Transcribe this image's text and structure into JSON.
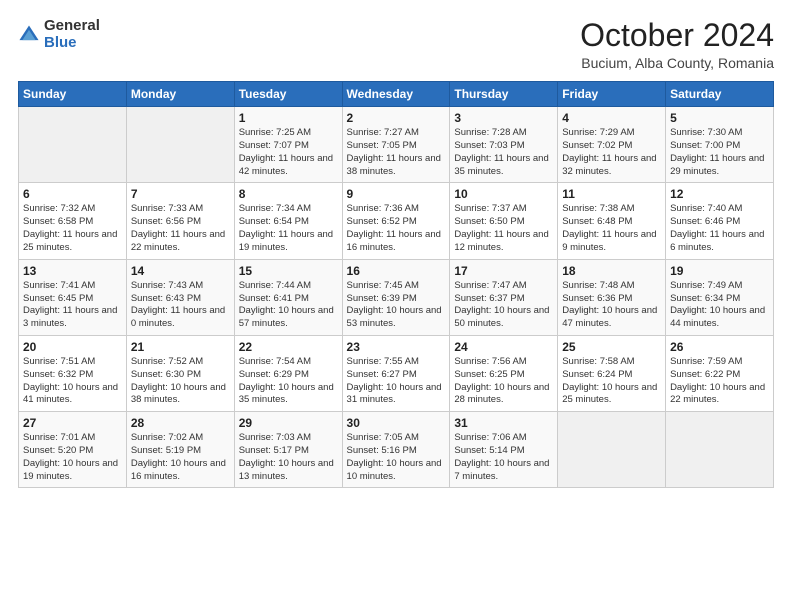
{
  "header": {
    "logo_general": "General",
    "logo_blue": "Blue",
    "month_title": "October 2024",
    "location": "Bucium, Alba County, Romania"
  },
  "days_of_week": [
    "Sunday",
    "Monday",
    "Tuesday",
    "Wednesday",
    "Thursday",
    "Friday",
    "Saturday"
  ],
  "weeks": [
    [
      {
        "day": "",
        "info": ""
      },
      {
        "day": "",
        "info": ""
      },
      {
        "day": "1",
        "info": "Sunrise: 7:25 AM\nSunset: 7:07 PM\nDaylight: 11 hours and 42 minutes."
      },
      {
        "day": "2",
        "info": "Sunrise: 7:27 AM\nSunset: 7:05 PM\nDaylight: 11 hours and 38 minutes."
      },
      {
        "day": "3",
        "info": "Sunrise: 7:28 AM\nSunset: 7:03 PM\nDaylight: 11 hours and 35 minutes."
      },
      {
        "day": "4",
        "info": "Sunrise: 7:29 AM\nSunset: 7:02 PM\nDaylight: 11 hours and 32 minutes."
      },
      {
        "day": "5",
        "info": "Sunrise: 7:30 AM\nSunset: 7:00 PM\nDaylight: 11 hours and 29 minutes."
      }
    ],
    [
      {
        "day": "6",
        "info": "Sunrise: 7:32 AM\nSunset: 6:58 PM\nDaylight: 11 hours and 25 minutes."
      },
      {
        "day": "7",
        "info": "Sunrise: 7:33 AM\nSunset: 6:56 PM\nDaylight: 11 hours and 22 minutes."
      },
      {
        "day": "8",
        "info": "Sunrise: 7:34 AM\nSunset: 6:54 PM\nDaylight: 11 hours and 19 minutes."
      },
      {
        "day": "9",
        "info": "Sunrise: 7:36 AM\nSunset: 6:52 PM\nDaylight: 11 hours and 16 minutes."
      },
      {
        "day": "10",
        "info": "Sunrise: 7:37 AM\nSunset: 6:50 PM\nDaylight: 11 hours and 12 minutes."
      },
      {
        "day": "11",
        "info": "Sunrise: 7:38 AM\nSunset: 6:48 PM\nDaylight: 11 hours and 9 minutes."
      },
      {
        "day": "12",
        "info": "Sunrise: 7:40 AM\nSunset: 6:46 PM\nDaylight: 11 hours and 6 minutes."
      }
    ],
    [
      {
        "day": "13",
        "info": "Sunrise: 7:41 AM\nSunset: 6:45 PM\nDaylight: 11 hours and 3 minutes."
      },
      {
        "day": "14",
        "info": "Sunrise: 7:43 AM\nSunset: 6:43 PM\nDaylight: 11 hours and 0 minutes."
      },
      {
        "day": "15",
        "info": "Sunrise: 7:44 AM\nSunset: 6:41 PM\nDaylight: 10 hours and 57 minutes."
      },
      {
        "day": "16",
        "info": "Sunrise: 7:45 AM\nSunset: 6:39 PM\nDaylight: 10 hours and 53 minutes."
      },
      {
        "day": "17",
        "info": "Sunrise: 7:47 AM\nSunset: 6:37 PM\nDaylight: 10 hours and 50 minutes."
      },
      {
        "day": "18",
        "info": "Sunrise: 7:48 AM\nSunset: 6:36 PM\nDaylight: 10 hours and 47 minutes."
      },
      {
        "day": "19",
        "info": "Sunrise: 7:49 AM\nSunset: 6:34 PM\nDaylight: 10 hours and 44 minutes."
      }
    ],
    [
      {
        "day": "20",
        "info": "Sunrise: 7:51 AM\nSunset: 6:32 PM\nDaylight: 10 hours and 41 minutes."
      },
      {
        "day": "21",
        "info": "Sunrise: 7:52 AM\nSunset: 6:30 PM\nDaylight: 10 hours and 38 minutes."
      },
      {
        "day": "22",
        "info": "Sunrise: 7:54 AM\nSunset: 6:29 PM\nDaylight: 10 hours and 35 minutes."
      },
      {
        "day": "23",
        "info": "Sunrise: 7:55 AM\nSunset: 6:27 PM\nDaylight: 10 hours and 31 minutes."
      },
      {
        "day": "24",
        "info": "Sunrise: 7:56 AM\nSunset: 6:25 PM\nDaylight: 10 hours and 28 minutes."
      },
      {
        "day": "25",
        "info": "Sunrise: 7:58 AM\nSunset: 6:24 PM\nDaylight: 10 hours and 25 minutes."
      },
      {
        "day": "26",
        "info": "Sunrise: 7:59 AM\nSunset: 6:22 PM\nDaylight: 10 hours and 22 minutes."
      }
    ],
    [
      {
        "day": "27",
        "info": "Sunrise: 7:01 AM\nSunset: 5:20 PM\nDaylight: 10 hours and 19 minutes."
      },
      {
        "day": "28",
        "info": "Sunrise: 7:02 AM\nSunset: 5:19 PM\nDaylight: 10 hours and 16 minutes."
      },
      {
        "day": "29",
        "info": "Sunrise: 7:03 AM\nSunset: 5:17 PM\nDaylight: 10 hours and 13 minutes."
      },
      {
        "day": "30",
        "info": "Sunrise: 7:05 AM\nSunset: 5:16 PM\nDaylight: 10 hours and 10 minutes."
      },
      {
        "day": "31",
        "info": "Sunrise: 7:06 AM\nSunset: 5:14 PM\nDaylight: 10 hours and 7 minutes."
      },
      {
        "day": "",
        "info": ""
      },
      {
        "day": "",
        "info": ""
      }
    ]
  ]
}
